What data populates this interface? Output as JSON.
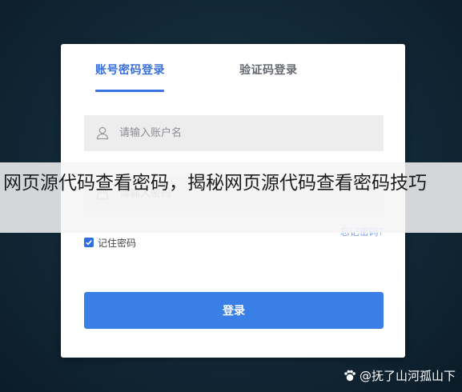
{
  "tabs": {
    "account_login": "账号密码登录",
    "sms_login": "验证码登录"
  },
  "username": {
    "placeholder": "请输入账户名",
    "icon": "user-icon"
  },
  "password": {
    "placeholder": "请输入密码",
    "icon": "lock-icon"
  },
  "remember": {
    "label": "记住密码",
    "checked": true
  },
  "forgot_label": "忘记密码?",
  "login_label": "登录",
  "banner": {
    "text": "网页源代码查看密码，揭秘网页源代码查看密码技巧"
  },
  "watermark": {
    "text": "@抚了山河孤山下"
  },
  "colors": {
    "accent": "#3a7ee8",
    "background": "#0f2231",
    "field": "#ededee"
  }
}
